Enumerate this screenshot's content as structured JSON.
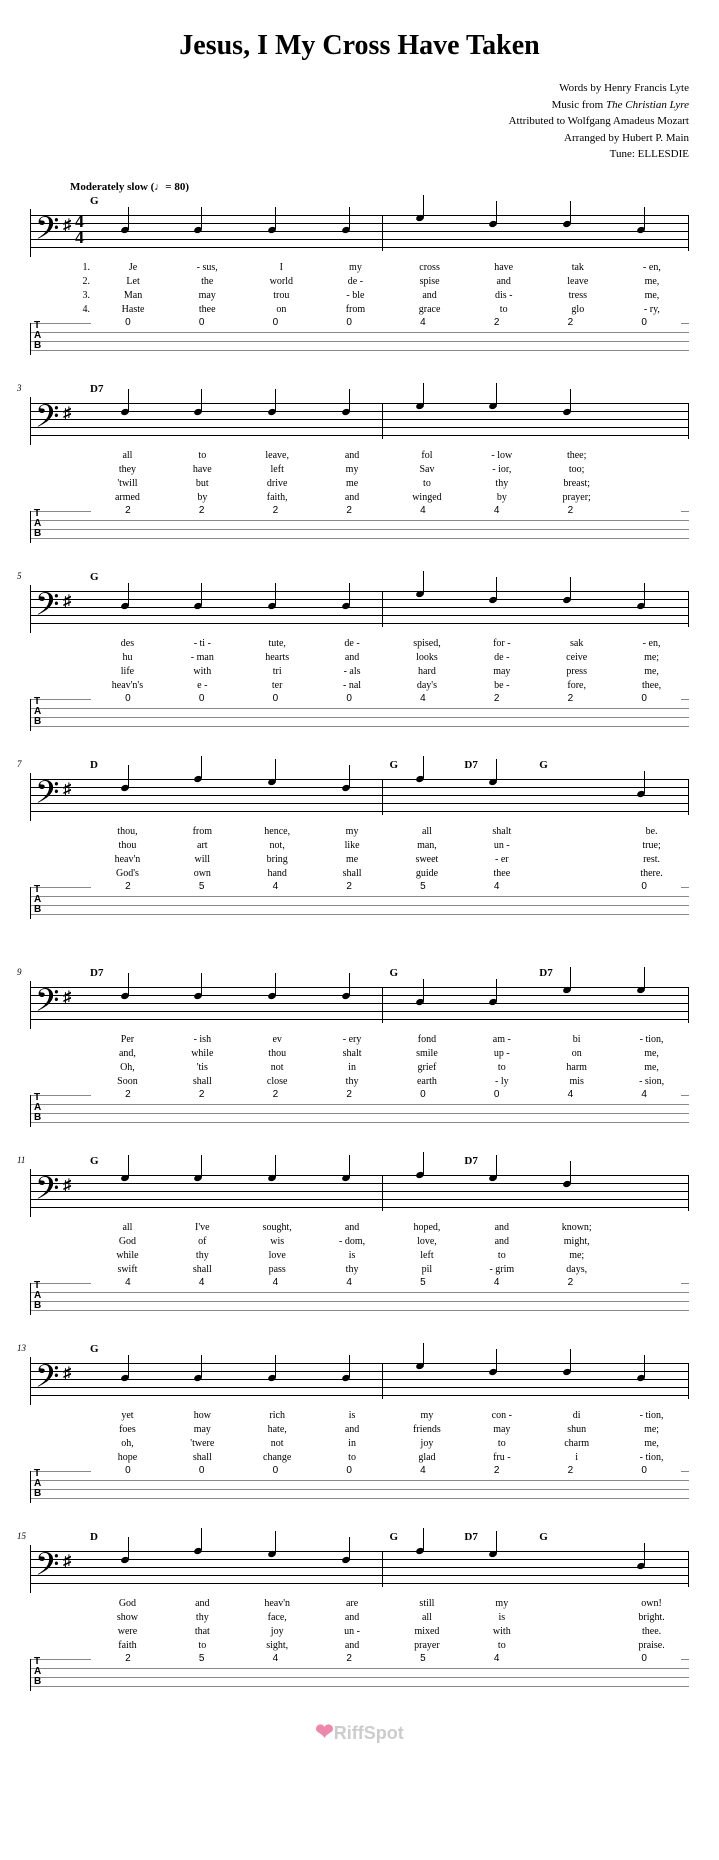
{
  "title": "Jesus, I My Cross Have Taken",
  "credits": {
    "line1": "Words by Henry Francis Lyte",
    "line2_a": "Music from ",
    "line2_b": "The Christian Lyre",
    "line3": "Attributed to Wolfgang Amadeus Mozart",
    "line4": "Arranged by Hubert P. Main",
    "line5": "Tune: ELLESDIE"
  },
  "tempo": "Moderately slow  (♩= 80)",
  "time_sig_top": "4",
  "time_sig_bot": "4",
  "systems": [
    {
      "mnum": "",
      "chords": [
        "G",
        "",
        "",
        "",
        "",
        "",
        "",
        ""
      ],
      "tabs": [
        "0",
        "0",
        "0",
        "0",
        "4",
        "2",
        "2",
        "0"
      ],
      "showClef": true,
      "lyrics": [
        [
          "Je",
          "- sus,",
          "I",
          "my",
          "cross",
          "have",
          "tak",
          "- en,"
        ],
        [
          "Let",
          "the",
          "world",
          "de -",
          "spise",
          "and",
          "leave",
          "me,"
        ],
        [
          "Man",
          "may",
          "trou",
          "- ble",
          "and",
          "dis -",
          "tress",
          "me,"
        ],
        [
          "Haste",
          "thee",
          "on",
          "from",
          "grace",
          "to",
          "glo",
          "- ry,"
        ]
      ],
      "verseNums": [
        "1.",
        "2.",
        "3.",
        "4."
      ]
    },
    {
      "mnum": "3",
      "chords": [
        "D7",
        "",
        "",
        "",
        "",
        "",
        "",
        ""
      ],
      "tabs": [
        "2",
        "2",
        "2",
        "2",
        "4",
        "4",
        "2",
        ""
      ],
      "lyrics": [
        [
          "all",
          "to",
          "leave,",
          "and",
          "fol",
          "- low",
          "thee;",
          ""
        ],
        [
          "they",
          "have",
          "left",
          "my",
          "Sav",
          "- ior,",
          "too;",
          ""
        ],
        [
          "'twill",
          "but",
          "drive",
          "me",
          "to",
          "thy",
          "breast;",
          ""
        ],
        [
          "armed",
          "by",
          "faith,",
          "and",
          "winged",
          "by",
          "prayer;",
          ""
        ]
      ]
    },
    {
      "mnum": "5",
      "chords": [
        "G",
        "",
        "",
        "",
        "",
        "",
        "",
        ""
      ],
      "tabs": [
        "0",
        "0",
        "0",
        "0",
        "4",
        "2",
        "2",
        "0"
      ],
      "lyrics": [
        [
          "des",
          "- ti -",
          "tute,",
          "de -",
          "spised,",
          "for -",
          "sak",
          "- en,"
        ],
        [
          "hu",
          "- man",
          "hearts",
          "and",
          "looks",
          "de -",
          "ceive",
          "me;"
        ],
        [
          "life",
          "with",
          "tri",
          "- als",
          "hard",
          "may",
          "press",
          "me,"
        ],
        [
          "heav'n's",
          "e -",
          "ter",
          "- nal",
          "day's",
          "be -",
          "fore,",
          "thee,"
        ]
      ]
    },
    {
      "mnum": "7",
      "chords": [
        "D",
        "",
        "",
        "",
        "G",
        "D7",
        "G",
        ""
      ],
      "tabs": [
        "2",
        "5",
        "4",
        "2",
        "5",
        "4",
        "",
        "0"
      ],
      "lyrics": [
        [
          "thou,",
          "from",
          "hence,",
          "my",
          "all",
          "shalt",
          "",
          "be."
        ],
        [
          "thou",
          "art",
          "not,",
          "like",
          "man,",
          "un -",
          "",
          "true;"
        ],
        [
          "heav'n",
          "will",
          "bring",
          "me",
          "sweet",
          "- er",
          "",
          "rest."
        ],
        [
          "God's",
          "own",
          "hand",
          "shall",
          "guide",
          "thee",
          "",
          "there."
        ]
      ]
    },
    {
      "gap": true,
      "mnum": "9",
      "chords": [
        "D7",
        "",
        "",
        "",
        "G",
        "",
        "D7",
        ""
      ],
      "tabs": [
        "2",
        "2",
        "2",
        "2",
        "0",
        "0",
        "4",
        "4"
      ],
      "lyrics": [
        [
          "Per",
          "- ish",
          "ev",
          "- ery",
          "fond",
          "am -",
          "bi",
          "- tion,"
        ],
        [
          "and,",
          "while",
          "thou",
          "shalt",
          "smile",
          "up -",
          "on",
          "me,"
        ],
        [
          "Oh,",
          "'tis",
          "not",
          "in",
          "grief",
          "to",
          "harm",
          "me,"
        ],
        [
          "Soon",
          "shall",
          "close",
          "thy",
          "earth",
          "- ly",
          "mis",
          "- sion,"
        ]
      ]
    },
    {
      "mnum": "11",
      "chords": [
        "G",
        "",
        "",
        "",
        "",
        "D7",
        "",
        ""
      ],
      "tabs": [
        "4",
        "4",
        "4",
        "4",
        "5",
        "4",
        "2",
        ""
      ],
      "lyrics": [
        [
          "all",
          "I've",
          "sought,",
          "and",
          "hoped,",
          "and",
          "known;",
          ""
        ],
        [
          "God",
          "of",
          "wis",
          "- dom,",
          "love,",
          "and",
          "might,",
          ""
        ],
        [
          "while",
          "thy",
          "love",
          "is",
          "left",
          "to",
          "me;",
          ""
        ],
        [
          "swift",
          "shall",
          "pass",
          "thy",
          "pil",
          "- grim",
          "days,",
          ""
        ]
      ]
    },
    {
      "mnum": "13",
      "chords": [
        "G",
        "",
        "",
        "",
        "",
        "",
        "",
        ""
      ],
      "tabs": [
        "0",
        "0",
        "0",
        "0",
        "4",
        "2",
        "2",
        "0"
      ],
      "lyrics": [
        [
          "yet",
          "how",
          "rich",
          "is",
          "my",
          "con -",
          "di",
          "- tion,"
        ],
        [
          "foes",
          "may",
          "hate,",
          "and",
          "friends",
          "may",
          "shun",
          "me;"
        ],
        [
          "oh,",
          "'twere",
          "not",
          "in",
          "joy",
          "to",
          "charm",
          "me,"
        ],
        [
          "hope",
          "shall",
          "change",
          "to",
          "glad",
          "fru -",
          "i",
          "- tion,"
        ]
      ]
    },
    {
      "mnum": "15",
      "chords": [
        "D",
        "",
        "",
        "",
        "G",
        "D7",
        "G",
        ""
      ],
      "tabs": [
        "2",
        "5",
        "4",
        "2",
        "5",
        "4",
        "",
        "0"
      ],
      "lyrics": [
        [
          "God",
          "and",
          "heav'n",
          "are",
          "still",
          "my",
          "",
          "own!"
        ],
        [
          "show",
          "thy",
          "face,",
          "and",
          "all",
          "is",
          "",
          "bright."
        ],
        [
          "were",
          "that",
          "joy",
          "un -",
          "mixed",
          "with",
          "",
          "thee."
        ],
        [
          "faith",
          "to",
          "sight,",
          "and",
          "prayer",
          "to",
          "",
          "praise."
        ]
      ]
    }
  ],
  "tab_label": [
    "T",
    "A",
    "B"
  ],
  "watermark": "RiffSpot"
}
